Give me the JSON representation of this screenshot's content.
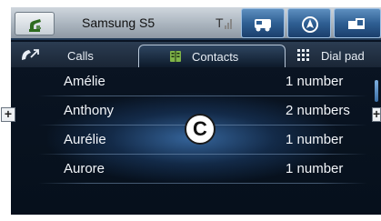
{
  "statusbar": {
    "device_name": "Samsung S5",
    "icons": [
      "phone-handset-icon",
      "signal-strength-icon",
      "vehicle-phone-icon",
      "navigation-icon",
      "media-icon"
    ]
  },
  "tabs": [
    {
      "label": "Calls",
      "icon": "call-log-icon",
      "active": false
    },
    {
      "label": "Contacts",
      "icon": "contacts-book-icon",
      "active": true
    },
    {
      "label": "Dial pad",
      "icon": "dialpad-icon",
      "active": false
    }
  ],
  "contacts": [
    {
      "name": "Amélie",
      "numbers": "1 number"
    },
    {
      "name": "Anthony",
      "numbers": "2 numbers"
    },
    {
      "name": "Aurélie",
      "numbers": "1 number"
    },
    {
      "name": "Aurore",
      "numbers": "1 number"
    }
  ],
  "callout": {
    "letter": "C"
  },
  "side_buttons": {
    "left": "+",
    "right": "+"
  },
  "colors": {
    "accent": "#2f5f93",
    "highlight": "#4480c4",
    "background": "#0b1524"
  }
}
